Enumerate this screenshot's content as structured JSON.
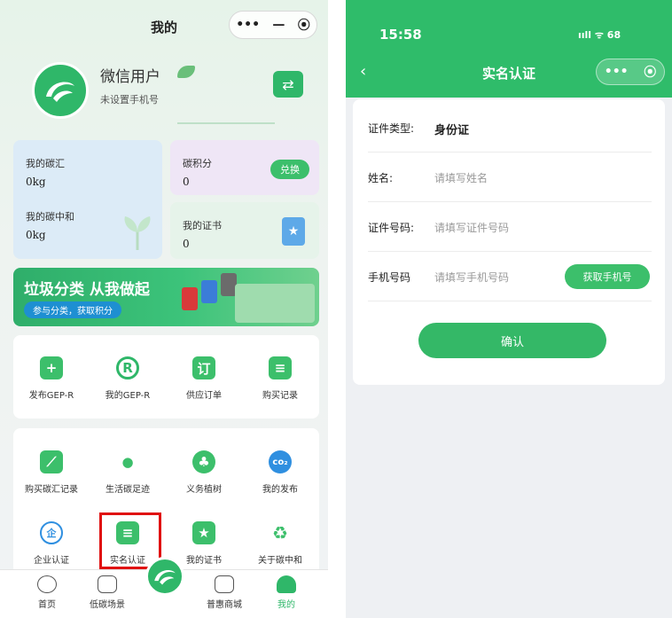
{
  "left": {
    "title": "我的",
    "capsule": {
      "more": "•••",
      "minus": "—",
      "close": "⦿"
    },
    "user": {
      "name": "微信用户",
      "phone": "未设置手机号"
    },
    "stats": {
      "carbon_sink": {
        "label": "我的碳汇",
        "value": "0kg"
      },
      "carbon_points": {
        "label": "碳积分",
        "value": "0",
        "action": "兑换"
      },
      "carbon_neutral": {
        "label": "我的碳中和",
        "value": "0kg"
      },
      "certificate": {
        "label": "我的证书",
        "value": "0"
      }
    },
    "banner": {
      "title": "垃圾分类 从我做起",
      "subtitle": "参与分类，获取积分"
    },
    "grid1": [
      {
        "label": "发布GEP-R",
        "icon": "plus-icon",
        "glyph": "+"
      },
      {
        "label": "我的GEP-R",
        "icon": "r-badge-icon",
        "glyph": "R"
      },
      {
        "label": "供应订单",
        "icon": "order-icon",
        "glyph": "订"
      },
      {
        "label": "购买记录",
        "icon": "purchase-record-icon",
        "glyph": "≡"
      }
    ],
    "grid2": [
      {
        "label": "购买碳汇记录",
        "icon": "leaf-record-icon",
        "glyph": "⟋"
      },
      {
        "label": "生活碳足迹",
        "icon": "footprint-icon",
        "glyph": "●"
      },
      {
        "label": "义务植树",
        "icon": "tree-icon",
        "glyph": "♣"
      },
      {
        "label": "我的发布",
        "icon": "co2-icon",
        "glyph": "co₂"
      },
      {
        "label": "企业认证",
        "icon": "enterprise-icon",
        "glyph": "企"
      },
      {
        "label": "实名认证",
        "icon": "id-card-icon",
        "glyph": "≡"
      },
      {
        "label": "我的证书",
        "icon": "certificate-icon",
        "glyph": "★"
      },
      {
        "label": "关于碳中和",
        "icon": "recycle-icon",
        "glyph": "♻"
      }
    ],
    "tabs": [
      {
        "label": "首页"
      },
      {
        "label": "低碳场景"
      },
      {
        "label": "普惠商城"
      },
      {
        "label": "我的"
      }
    ],
    "colors": {
      "brand": "#2fb769",
      "tab_active": "#2fb769",
      "highlight": "#e01010"
    }
  },
  "right": {
    "status_time": "15:58",
    "status_right": "ııll ᯤ 68",
    "back": "‹",
    "title": "实名认证",
    "capsule": {
      "more": "•••",
      "close": "⦿"
    },
    "form": {
      "id_type": {
        "label": "证件类型:",
        "value": "身份证"
      },
      "name": {
        "label": "姓名:",
        "placeholder": "请填写姓名"
      },
      "id_number": {
        "label": "证件号码:",
        "placeholder": "请填写证件号码"
      },
      "phone": {
        "label": "手机号码",
        "placeholder": "请填写手机号码",
        "action": "获取手机号"
      }
    },
    "confirm": "确认"
  }
}
